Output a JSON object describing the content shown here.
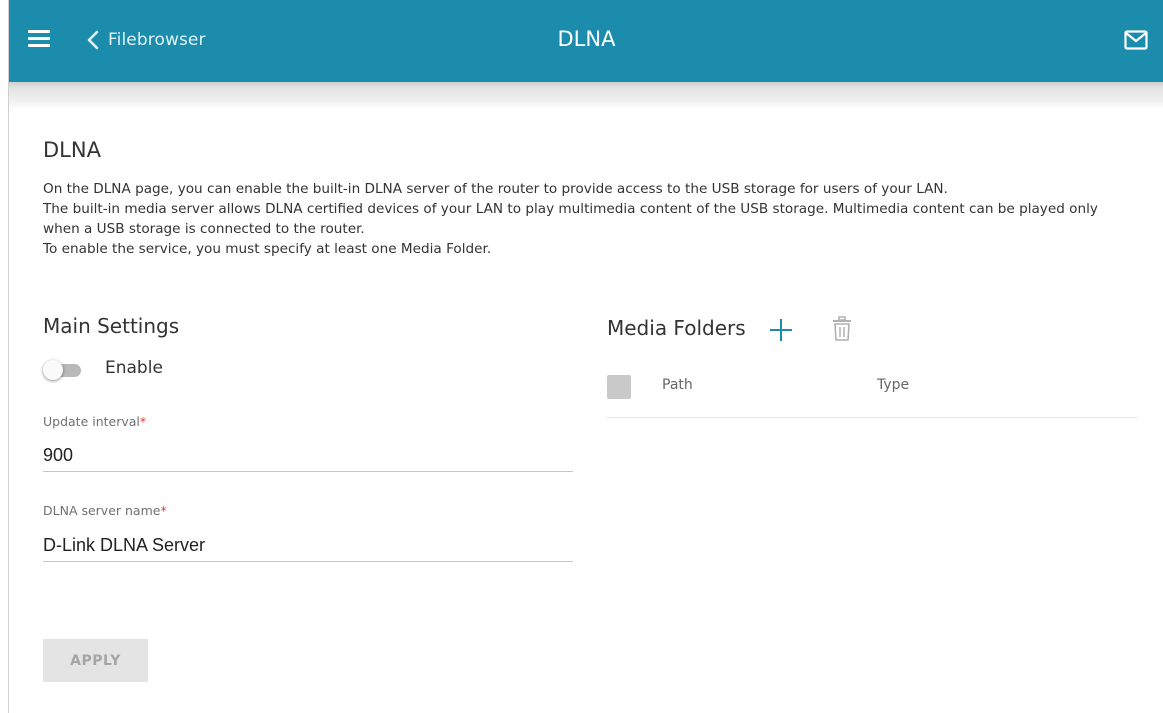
{
  "header": {
    "back_label": "Filebrowser",
    "title": "DLNA",
    "color": "#1c8cac"
  },
  "section": {
    "title": "DLNA",
    "description": [
      "On the DLNA page, you can enable the built-in DLNA server of the router to provide access to the USB storage for users of your LAN.",
      "The built-in media server allows DLNA certified devices of your LAN to play multimedia content of the USB storage. Multimedia content can be played only when a USB storage is connected to the router.",
      "To enable the service, you must specify at least one Media Folder."
    ]
  },
  "main_settings": {
    "title": "Main Settings",
    "enable_label": "Enable",
    "enable_on": false,
    "update_interval": {
      "label": "Update interval",
      "required_mark": "*",
      "value": "900"
    },
    "server_name": {
      "label": "DLNA server name",
      "required_mark": "*",
      "value": "D-Link DLNA Server"
    }
  },
  "media_folders": {
    "title": "Media Folders",
    "columns": [
      "Path",
      "Type"
    ],
    "rows": []
  },
  "actions": {
    "apply_label": "APPLY"
  },
  "icons": {
    "menu": "hamburger-menu-icon",
    "back": "chevron-left-icon",
    "mail": "envelope-icon",
    "add": "plus-icon",
    "delete": "trash-icon"
  }
}
